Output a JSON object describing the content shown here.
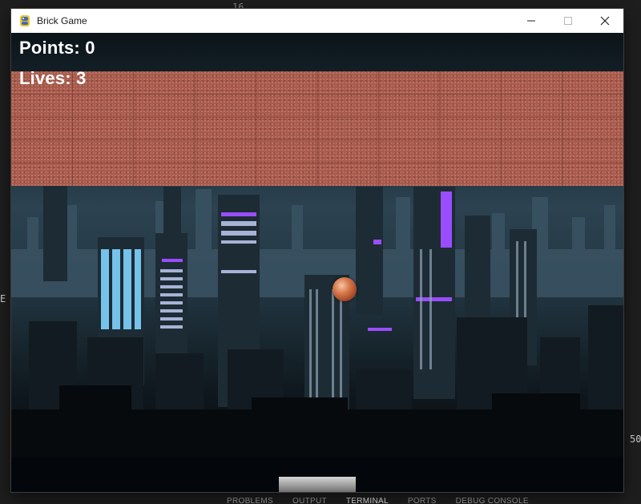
{
  "window": {
    "title": "Brick Game",
    "controls": [
      "minimize",
      "maximize",
      "close"
    ]
  },
  "hud": {
    "points_text": "Points: 0",
    "lives_text": "Lives: 3"
  },
  "game": {
    "brick_rows": 5,
    "brick_columns": 10,
    "brick_color": "#a85a4c",
    "ball_color": "#d97b4d",
    "paddle_color": "#a0a0a0"
  },
  "ide": {
    "line_number": "16",
    "left_glyph": "E",
    "right_number": "50",
    "panel_tabs": [
      "PROBLEMS",
      "OUTPUT",
      "TERMINAL",
      "PORTS",
      "DEBUG CONSOLE"
    ],
    "active_tab": "TERMINAL"
  },
  "colors": {
    "ide_background": "#1e1e1e",
    "titlebar": "#ffffff"
  }
}
